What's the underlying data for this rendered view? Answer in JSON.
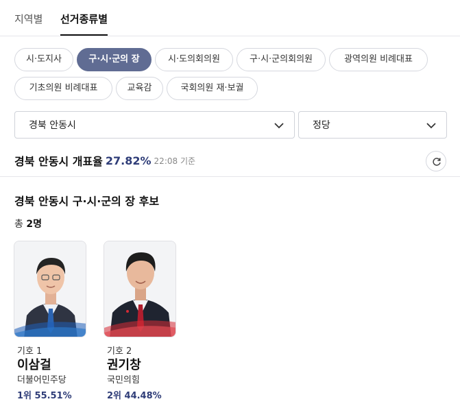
{
  "top_tabs": [
    {
      "label": "지역별",
      "active": false
    },
    {
      "label": "선거종류별",
      "active": true
    }
  ],
  "election_types": [
    {
      "label": "시·도지사",
      "active": false
    },
    {
      "label": "구·시·군의 장",
      "active": true
    },
    {
      "label": "시·도의회의원",
      "active": false
    },
    {
      "label": "구·시·군의회의원",
      "active": false
    },
    {
      "label": "광역의원 비례대표",
      "active": false
    },
    {
      "label": "기초의원 비례대표",
      "active": false
    },
    {
      "label": "교육감",
      "active": false
    },
    {
      "label": "국회의원 재·보궐",
      "active": false
    }
  ],
  "filters": {
    "region": "경북 안동시",
    "party": "정당"
  },
  "count": {
    "region": "경북 안동시 개표율",
    "percent": "27.82%",
    "time": "22:08 기준"
  },
  "section": {
    "title": "경북 안동시 구·시·군의 장 후보",
    "total_prefix": "총",
    "total_value": "2명"
  },
  "candidates": [
    {
      "number": "기호 1",
      "name": "이삼걸",
      "party": "더불어민주당",
      "result": "1위 55.51%",
      "party_color": "#1f5fb8",
      "tie_color": "#2b63b0"
    },
    {
      "number": "기호 2",
      "name": "권기창",
      "party": "국민의힘",
      "result": "2위 44.48%",
      "party_color": "#d62b36",
      "tie_color": "#b01e2e"
    }
  ],
  "icons": {
    "dropdown": "chevron-down-icon",
    "refresh": "refresh-icon"
  }
}
